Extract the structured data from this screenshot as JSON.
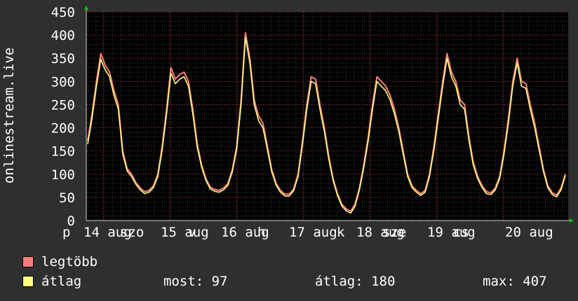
{
  "chart_data": {
    "type": "line",
    "ylabel": "onlinestream.live",
    "ylim": [
      0,
      450
    ],
    "yticks": [
      0,
      50,
      100,
      150,
      200,
      250,
      300,
      350,
      400,
      450
    ],
    "x_tick_labels": [
      "p 14 aug",
      "szo 15 aug",
      "v 16 aug",
      "h 17 aug",
      "k 18 aug",
      "sze 19 aug",
      "cs 20 aug"
    ],
    "x_label_segments": [
      {
        "text": "p"
      },
      {
        "text": "14 aug"
      },
      {
        "text": "szo"
      },
      {
        "text": "15 aug"
      },
      {
        "text": "v"
      },
      {
        "text": "16 aug"
      },
      {
        "text": "h"
      },
      {
        "text": "17 aug"
      },
      {
        "text": "k"
      },
      {
        "text": "18 aug"
      },
      {
        "text": "sze"
      },
      {
        "text": "19 aug"
      },
      {
        "text": "cs"
      },
      {
        "text": "20 aug"
      }
    ],
    "grid": true,
    "series": [
      {
        "name": "legtöbb",
        "color": "#ff7f7f",
        "values": [
          172,
          230,
          300,
          360,
          335,
          320,
          280,
          250,
          150,
          112,
          100,
          82,
          70,
          62,
          65,
          75,
          100,
          160,
          240,
          330,
          305,
          315,
          320,
          300,
          240,
          165,
          120,
          90,
          72,
          67,
          65,
          70,
          80,
          110,
          160,
          260,
          405,
          350,
          260,
          225,
          210,
          160,
          110,
          80,
          65,
          57,
          57,
          68,
          100,
          170,
          250,
          310,
          305,
          250,
          200,
          140,
          90,
          58,
          35,
          25,
          20,
          35,
          70,
          120,
          180,
          250,
          310,
          300,
          290,
          270,
          240,
          200,
          150,
          100,
          75,
          65,
          58,
          65,
          100,
          160,
          230,
          300,
          360,
          320,
          300,
          260,
          250,
          180,
          125,
          95,
          75,
          62,
          60,
          70,
          95,
          150,
          220,
          300,
          350,
          300,
          295,
          250,
          210,
          160,
          110,
          75,
          60,
          55,
          70,
          100
        ]
      },
      {
        "name": "átlag",
        "color": "#ffff7f",
        "values": [
          165,
          220,
          290,
          348,
          325,
          310,
          270,
          240,
          143,
          107,
          95,
          78,
          66,
          58,
          61,
          71,
          95,
          152,
          230,
          318,
          295,
          305,
          310,
          290,
          230,
          158,
          115,
          86,
          68,
          63,
          61,
          66,
          76,
          105,
          153,
          250,
          395,
          340,
          250,
          215,
          200,
          153,
          105,
          76,
          61,
          53,
          53,
          64,
          95,
          162,
          240,
          300,
          295,
          240,
          192,
          133,
          86,
          54,
          31,
          21,
          16,
          31,
          66,
          114,
          172,
          240,
          300,
          290,
          280,
          260,
          230,
          192,
          143,
          95,
          71,
          61,
          54,
          61,
          95,
          152,
          220,
          290,
          350,
          310,
          290,
          250,
          240,
          172,
          119,
          90,
          71,
          58,
          56,
          66,
          90,
          143,
          210,
          290,
          340,
          290,
          285,
          240,
          200,
          153,
          105,
          71,
          56,
          51,
          66,
          97
        ]
      }
    ],
    "legend": {
      "placement": "bottom-left",
      "items": [
        {
          "label": "legtöbb",
          "color": "#ff7f7f"
        },
        {
          "label": "átlag",
          "color": "#ffff7f"
        }
      ]
    },
    "stats": {
      "current": "most: 97",
      "average": "átlag: 180",
      "max": "max: 407"
    }
  }
}
